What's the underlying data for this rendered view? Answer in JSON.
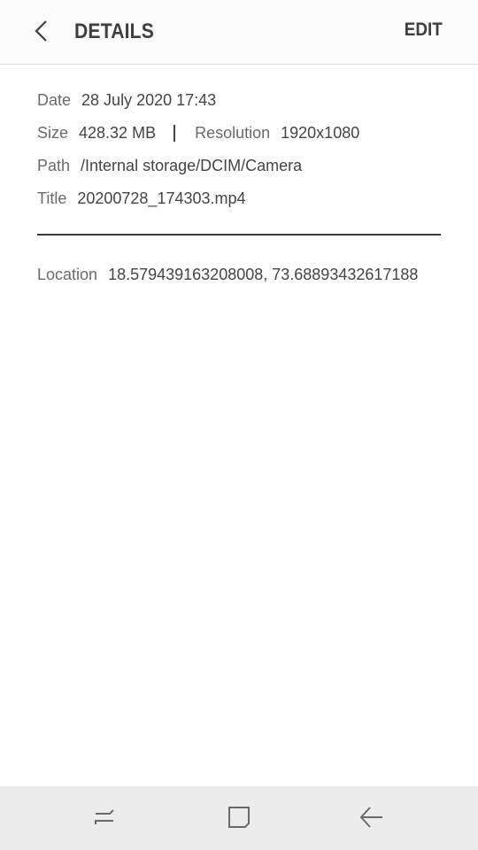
{
  "header": {
    "title": "DETAILS",
    "edit_label": "EDIT"
  },
  "details": {
    "date": {
      "label": "Date",
      "value": "28 July 2020 17:43"
    },
    "size": {
      "label": "Size",
      "value": "428.32 MB"
    },
    "resolution": {
      "label": "Resolution",
      "value": "1920x1080"
    },
    "path": {
      "label": "Path",
      "value": "/Internal storage/DCIM/Camera"
    },
    "title": {
      "label": "Title",
      "value": "20200728_174303.mp4"
    },
    "location": {
      "label": "Location",
      "value": "18.579439163208008, 73.68893432617188"
    }
  },
  "icons": {
    "back": "chevron-left-icon",
    "recents": "recents-icon",
    "home": "home-icon",
    "nav_back": "arrow-left-icon"
  },
  "colors": {
    "app_bar": "#fafafa",
    "text": "#444444",
    "label": "#6a6a6a",
    "nav_bar": "#ececec"
  }
}
